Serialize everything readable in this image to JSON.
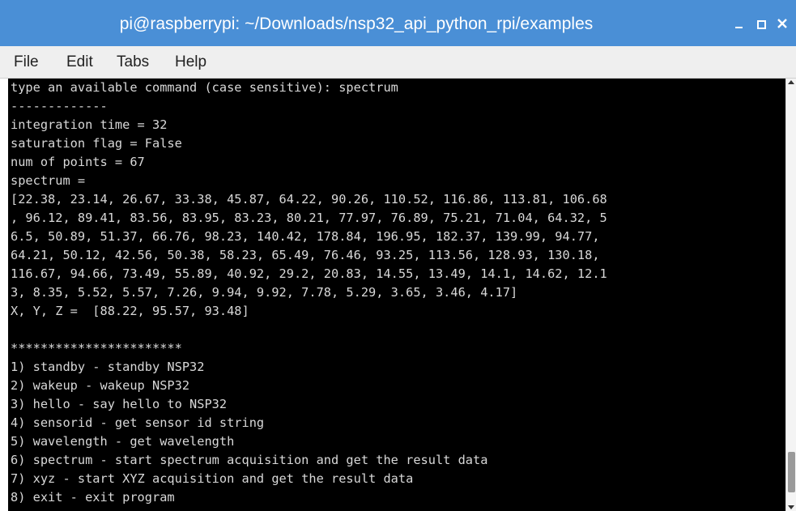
{
  "window": {
    "title": "pi@raspberrypi: ~/Downloads/nsp32_api_python_rpi/examples",
    "minimize_icon": "minimize-icon",
    "maximize_icon": "maximize-icon",
    "close_icon": "close-icon"
  },
  "menu": {
    "file": "File",
    "edit": "Edit",
    "tabs": "Tabs",
    "help": "Help"
  },
  "terminal": {
    "lines": [
      "type an available command (case sensitive): spectrum",
      "-------------",
      "integration time = 32",
      "saturation flag = False",
      "num of points = 67",
      "spectrum =",
      "[22.38, 23.14, 26.67, 33.38, 45.87, 64.22, 90.26, 110.52, 116.86, 113.81, 106.68",
      ", 96.12, 89.41, 83.56, 83.95, 83.23, 80.21, 77.97, 76.89, 75.21, 71.04, 64.32, 5",
      "6.5, 50.89, 51.37, 66.76, 98.23, 140.42, 178.84, 196.95, 182.37, 139.99, 94.77,",
      "64.21, 50.12, 42.56, 50.38, 58.23, 65.49, 76.46, 93.25, 113.56, 128.93, 130.18,",
      "116.67, 94.66, 73.49, 55.89, 40.92, 29.2, 20.83, 14.55, 13.49, 14.1, 14.62, 12.1",
      "3, 8.35, 5.52, 5.57, 7.26, 9.94, 9.92, 7.78, 5.29, 3.65, 3.46, 4.17]",
      "X, Y, Z =  [88.22, 95.57, 93.48]",
      "",
      "***********************",
      "1) standby - standby NSP32",
      "2) wakeup - wakeup NSP32",
      "3) hello - say hello to NSP32",
      "4) sensorid - get sensor id string",
      "5) wavelength - get wavelength",
      "6) spectrum - start spectrum acquisition and get the result data",
      "7) xyz - start XYZ acquisition and get the result data",
      "8) exit - exit program"
    ]
  },
  "scrollbar": {
    "up_icon": "scroll-up-arrow-icon",
    "down_icon": "scroll-down-arrow-icon"
  },
  "colors": {
    "titlebar": "#4a8fd6",
    "terminal_bg": "#000000",
    "terminal_fg": "#d8d8d8",
    "menubar": "#efefef"
  }
}
